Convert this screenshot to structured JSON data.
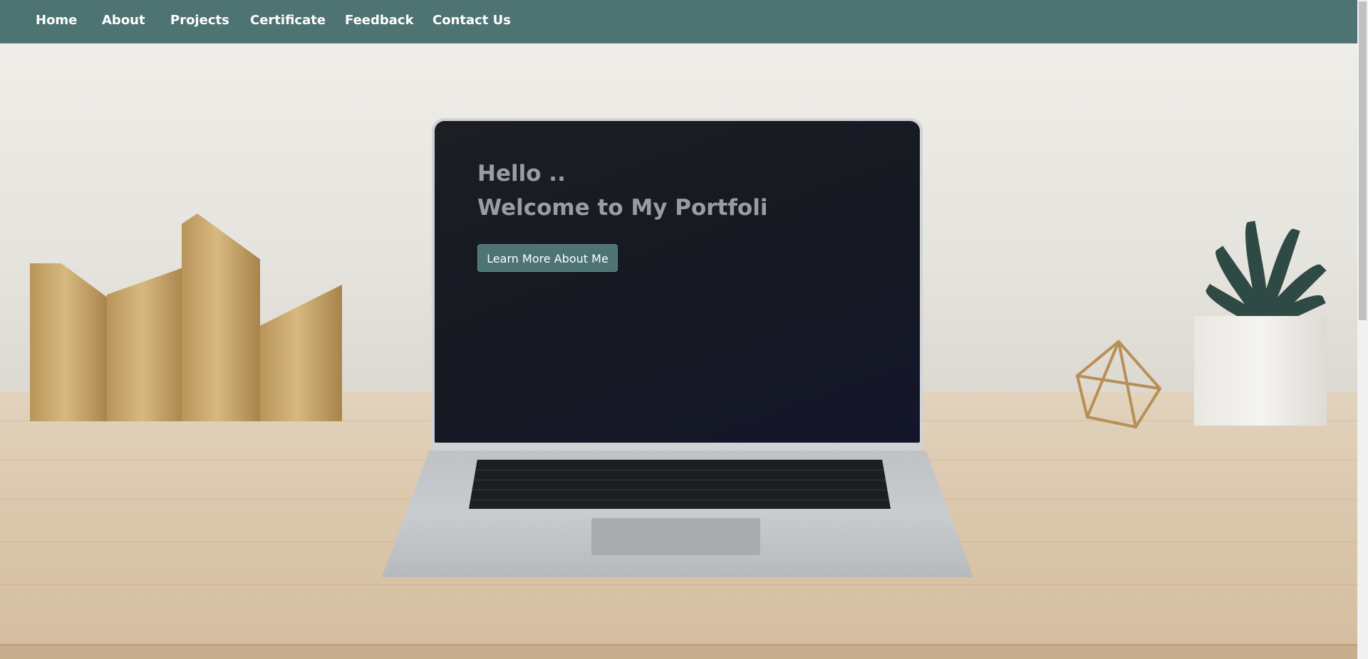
{
  "navbar": {
    "items": [
      {
        "label": "Home"
      },
      {
        "label": "About"
      },
      {
        "label": "Projects"
      },
      {
        "label": "Certificate"
      },
      {
        "label": "Feedback"
      },
      {
        "label": "Contact Us"
      }
    ]
  },
  "hero": {
    "greeting": "Hello ..",
    "welcome": "Welcome to My Portfoli",
    "cta_label": "Learn More About Me"
  },
  "colors": {
    "navbar_bg": "#4e7373",
    "button_bg": "#4e7373",
    "hero_text": "#9a9ca1",
    "nav_text": "#ffffff"
  }
}
